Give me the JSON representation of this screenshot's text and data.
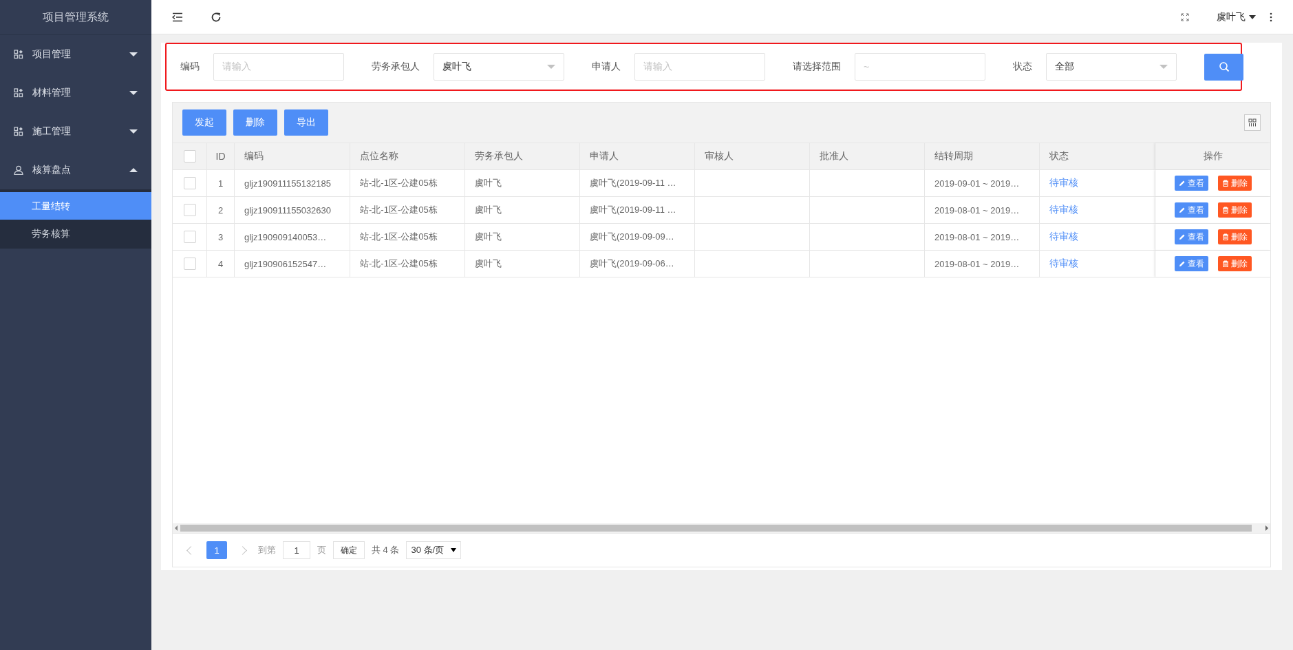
{
  "sidebar": {
    "title": "项目管理系统",
    "items": [
      {
        "label": "项目管理",
        "expanded": false
      },
      {
        "label": "材料管理",
        "expanded": false
      },
      {
        "label": "施工管理",
        "expanded": false
      },
      {
        "label": "核算盘点",
        "expanded": true,
        "children": [
          {
            "label": "工量结转",
            "selected": true
          },
          {
            "label": "劳务核算",
            "selected": false
          }
        ]
      }
    ]
  },
  "topbar": {
    "user": "虞叶飞"
  },
  "filters": [
    {
      "kind": "input",
      "label": "编码",
      "placeholder": "请输入"
    },
    {
      "kind": "select",
      "label": "劳务承包人",
      "value": "虞叶飞"
    },
    {
      "kind": "input",
      "label": "申请人",
      "placeholder": "请输入"
    },
    {
      "kind": "range",
      "label": "请选择范围",
      "placeholder": "~"
    },
    {
      "kind": "select",
      "label": "状态",
      "value": "全部"
    }
  ],
  "toolbar": {
    "buttons": [
      "发起",
      "删除",
      "导出"
    ]
  },
  "table": {
    "all_checked": false,
    "columns": [
      "ID",
      "编码",
      "点位名称",
      "劳务承包人",
      "申请人",
      "审核人",
      "批准人",
      "结转周期",
      "状态",
      "操作"
    ],
    "rows": [
      {
        "checked": false,
        "cells": [
          "1",
          "gljz190911155132185",
          "站-北-1区-公建05栋",
          "虞叶飞",
          "虞叶飞(2019-09-11 …",
          "",
          "",
          "2019-09-01 ~ 2019…",
          "待审核"
        ],
        "actions": [
          "查看",
          "删除"
        ]
      },
      {
        "checked": false,
        "cells": [
          "2",
          "gljz190911155032630",
          "站-北-1区-公建05栋",
          "虞叶飞",
          "虞叶飞(2019-09-11 …",
          "",
          "",
          "2019-08-01 ~ 2019…",
          "待审核"
        ],
        "actions": [
          "查看",
          "删除"
        ]
      },
      {
        "checked": false,
        "cells": [
          "3",
          "gljz190909140053…",
          "站-北-1区-公建05栋",
          "虞叶飞",
          "虞叶飞(2019-09-09…",
          "",
          "",
          "2019-08-01 ~ 2019…",
          "待审核"
        ],
        "actions": [
          "查看",
          "删除"
        ]
      },
      {
        "checked": false,
        "cells": [
          "4",
          "gljz190906152547…",
          "站-北-1区-公建05栋",
          "虞叶飞",
          "虞叶飞(2019-09-06…",
          "",
          "",
          "2019-08-01 ~ 2019…",
          "待审核"
        ],
        "actions": [
          "查看",
          "删除"
        ]
      }
    ]
  },
  "pagination": {
    "pages": [
      {
        "label": "1",
        "selected": true
      }
    ],
    "goto_label": "到第",
    "goto_value": "1",
    "page_unit": "页",
    "confirm": "确定",
    "total": "共 4 条",
    "page_size": "30 条/页"
  }
}
